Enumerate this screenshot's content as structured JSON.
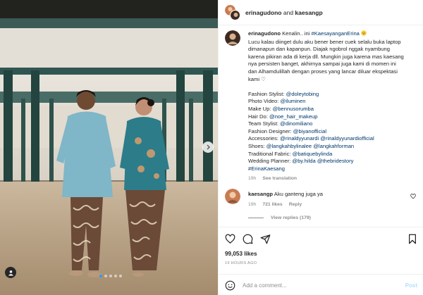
{
  "header": {
    "user1": "erinagudono",
    "joiner": "and",
    "user2": "kaesangp"
  },
  "caption": {
    "username": "erinagudono",
    "first_line_text": "Kenalin.. ini",
    "hashtag_first": "#KaesayanganErina",
    "emoji_icon": "grinning-face-emoji",
    "body_lines": [
      "Lucu kalau diinget dulu aku bener bener cuek selalu buka laptop",
      "dimanapun dan kapanpun. Diajak ngobrol nggak nyambung",
      "karena pikiran ada di kerja dll. Mungkin juga karena mas kaesang",
      "nya persisten banget, akhirnya sampai juga kami di momen ini",
      "dan Alhamdulillah dengan proses yang lancar diluar ekspektasi",
      "kami ♡"
    ],
    "credits": [
      {
        "label": "Fashion Stylist:",
        "links": [
          "@doleytobing"
        ]
      },
      {
        "label": "Photo Video:",
        "links": [
          "@iluminen"
        ]
      },
      {
        "label": "Make Up:",
        "links": [
          "@bennusorumba"
        ]
      },
      {
        "label": "Hair Do:",
        "links": [
          "@noe_hair_makeup"
        ]
      },
      {
        "label": "Team Stylist:",
        "links": [
          "@dinomiliano"
        ]
      },
      {
        "label": "Fashion Designer:",
        "links": [
          "@biyanofficial"
        ]
      },
      {
        "label": "Accessories:",
        "links": [
          "@rinaldyyunardi",
          "@rinaldyyunardiofficial"
        ]
      },
      {
        "label": "Shoes:",
        "links": [
          "@langkahbylinalee",
          "@langkahforman"
        ]
      },
      {
        "label": "Traditional Fabric:",
        "links": [
          "@batiquebylinda"
        ]
      },
      {
        "label": "Wedding Planner:",
        "links": [
          "@by.hilda",
          "@thebridestory"
        ]
      }
    ],
    "hashtag_last": "#ErinaKaesang",
    "age": "19h",
    "see_translation": "See translation"
  },
  "reply": {
    "username": "kaesangp",
    "text": "Aku ganteng juga ya",
    "age": "19h",
    "likes": "721 likes",
    "reply_label": "Reply"
  },
  "view_replies": "View replies (179)",
  "likes_count": "99,053 likes",
  "timestamp": "19 HOURS AGO",
  "comment_input": {
    "placeholder": "Add a comment...",
    "post_label": "Post"
  },
  "colors": {
    "link": "#00376b",
    "muted": "#8e8e8e",
    "post_disabled": "#b2dffc",
    "active_dot": "#3897f0"
  },
  "carousel": {
    "dots": 5,
    "active": 1
  }
}
